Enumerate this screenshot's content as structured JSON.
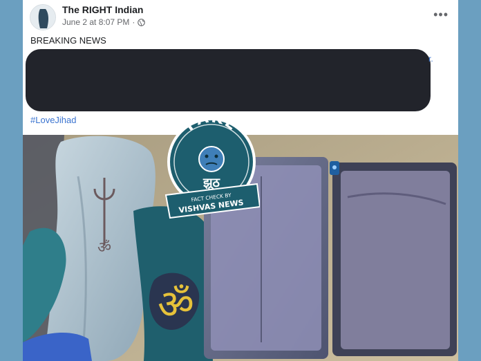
{
  "post": {
    "author": "The RIGHT Indian",
    "timestamp": "June 2 at 8:07 PM",
    "separator": "·",
    "privacy_icon": "globe-icon",
    "more_icon": "more-options-icon",
    "more_glyph": "•••",
    "text": "BREAKING NEWS",
    "hashtag": "#LoveJihad",
    "stray_text": "r."
  },
  "stamp": {
    "word": "FAKE",
    "script": "झूठ",
    "line1": "FACT CHECK BY",
    "line2": "VISHVAS NEWS"
  },
  "colors": {
    "background": "#6b9fc0",
    "card": "#ffffff",
    "redaction": "#22242b",
    "link": "#3b74d0",
    "stamp_teal": "#1d5e6e"
  }
}
